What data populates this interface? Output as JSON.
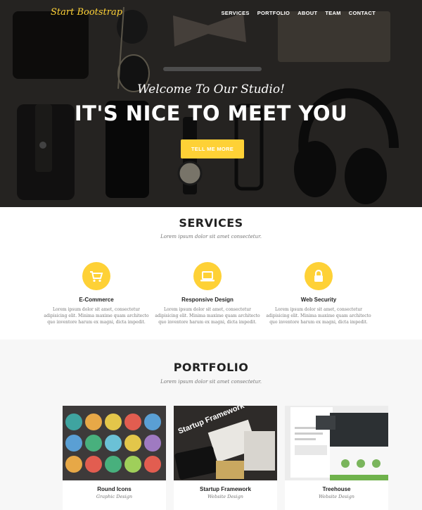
{
  "nav": {
    "brand": "Start Bootstrap",
    "links": [
      "SERVICES",
      "PORTFOLIO",
      "ABOUT",
      "TEAM",
      "CONTACT"
    ]
  },
  "hero": {
    "lead": "Welcome To Our Studio!",
    "heading": "IT'S NICE TO MEET YOU",
    "button": "TELL ME MORE"
  },
  "services": {
    "heading": "SERVICES",
    "subheading": "Lorem ipsum dolor sit amet consectetur.",
    "items": [
      {
        "icon": "shopping-cart-icon",
        "title": "E-Commerce",
        "desc": "Lorem ipsum dolor sit amet, consectetur adipisicing elit. Minima maxime quam architecto quo inventore harum ex magni, dicta impedit."
      },
      {
        "icon": "laptop-icon",
        "title": "Responsive Design",
        "desc": "Lorem ipsum dolor sit amet, consectetur adipisicing elit. Minima maxime quam architecto quo inventore harum ex magni, dicta impedit."
      },
      {
        "icon": "lock-icon",
        "title": "Web Security",
        "desc": "Lorem ipsum dolor sit amet, consectetur adipisicing elit. Minima maxime quam architecto quo inventore harum ex magni, dicta impedit."
      }
    ]
  },
  "portfolio": {
    "heading": "PORTFOLIO",
    "subheading": "Lorem ipsum dolor sit amet consectetur.",
    "items": [
      {
        "title": "Round Icons",
        "subtitle": "Graphic Design"
      },
      {
        "title": "Startup Framework",
        "subtitle": "Website Design",
        "image_text": "Startup Framework"
      },
      {
        "title": "Treehouse",
        "subtitle": "Website Design"
      }
    ]
  },
  "colors": {
    "accent": "#fed136",
    "dark": "#222222",
    "muted": "#777777",
    "light_bg": "#f7f7f7"
  }
}
